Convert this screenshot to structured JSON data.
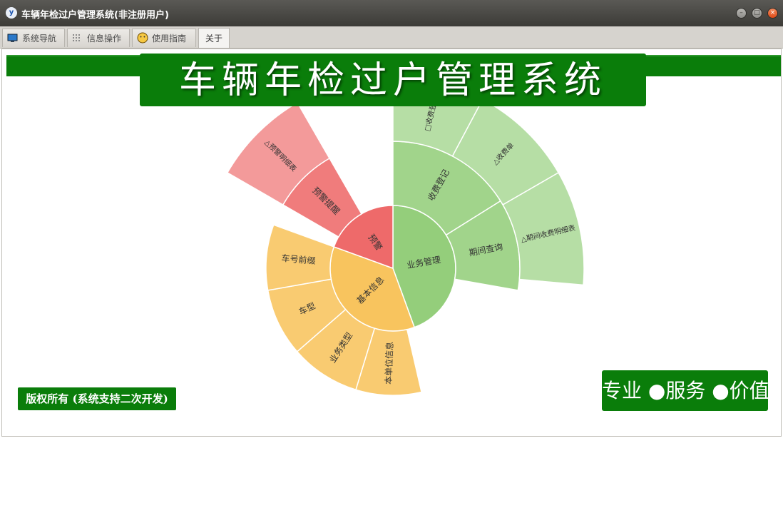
{
  "window": {
    "title": "车辆年检过户管理系统(非注册用户)",
    "icon": "app-logo-icon"
  },
  "tabs": [
    {
      "label": "系统导航",
      "icon": "monitor-icon"
    },
    {
      "label": "信息操作",
      "icon": "grid-icon"
    },
    {
      "label": "使用指南",
      "icon": "smiley-icon"
    },
    {
      "label": "关于",
      "icon": ""
    }
  ],
  "active_tab": "关于",
  "banner": {
    "title": "车辆年检过户管理系统"
  },
  "footer": {
    "copyright": "版权所有 (系统支持二次开发)",
    "slogan": "专业 ●服务 ●价值"
  },
  "colors": {
    "brand_green": "#0a7d0a",
    "red": "#ee6a6a",
    "orange": "#f8c45e",
    "green": "#94ce7b"
  },
  "chart_data": {
    "type": "sunburst",
    "root": [
      {
        "name": "业务管理",
        "color": "#94ce7b",
        "children": [
          {
            "name": "收费登记",
            "children": [
              {
                "name": "□收费登记"
              },
              {
                "name": "△收费单"
              }
            ]
          },
          {
            "name": "期间查询",
            "children": [
              {
                "name": "△期间收费明细表"
              }
            ]
          }
        ]
      },
      {
        "name": "基本信息",
        "color": "#f8c45e",
        "children": [
          {
            "name": "本单位信息"
          },
          {
            "name": "业务类型"
          },
          {
            "name": "车型"
          },
          {
            "name": "车号前缀"
          }
        ]
      },
      {
        "name": "预警",
        "color": "#ee6a6a",
        "children": [
          {
            "name": "预警提醒",
            "children": [
              {
                "name": "△预警明细表"
              }
            ]
          }
        ]
      }
    ]
  }
}
